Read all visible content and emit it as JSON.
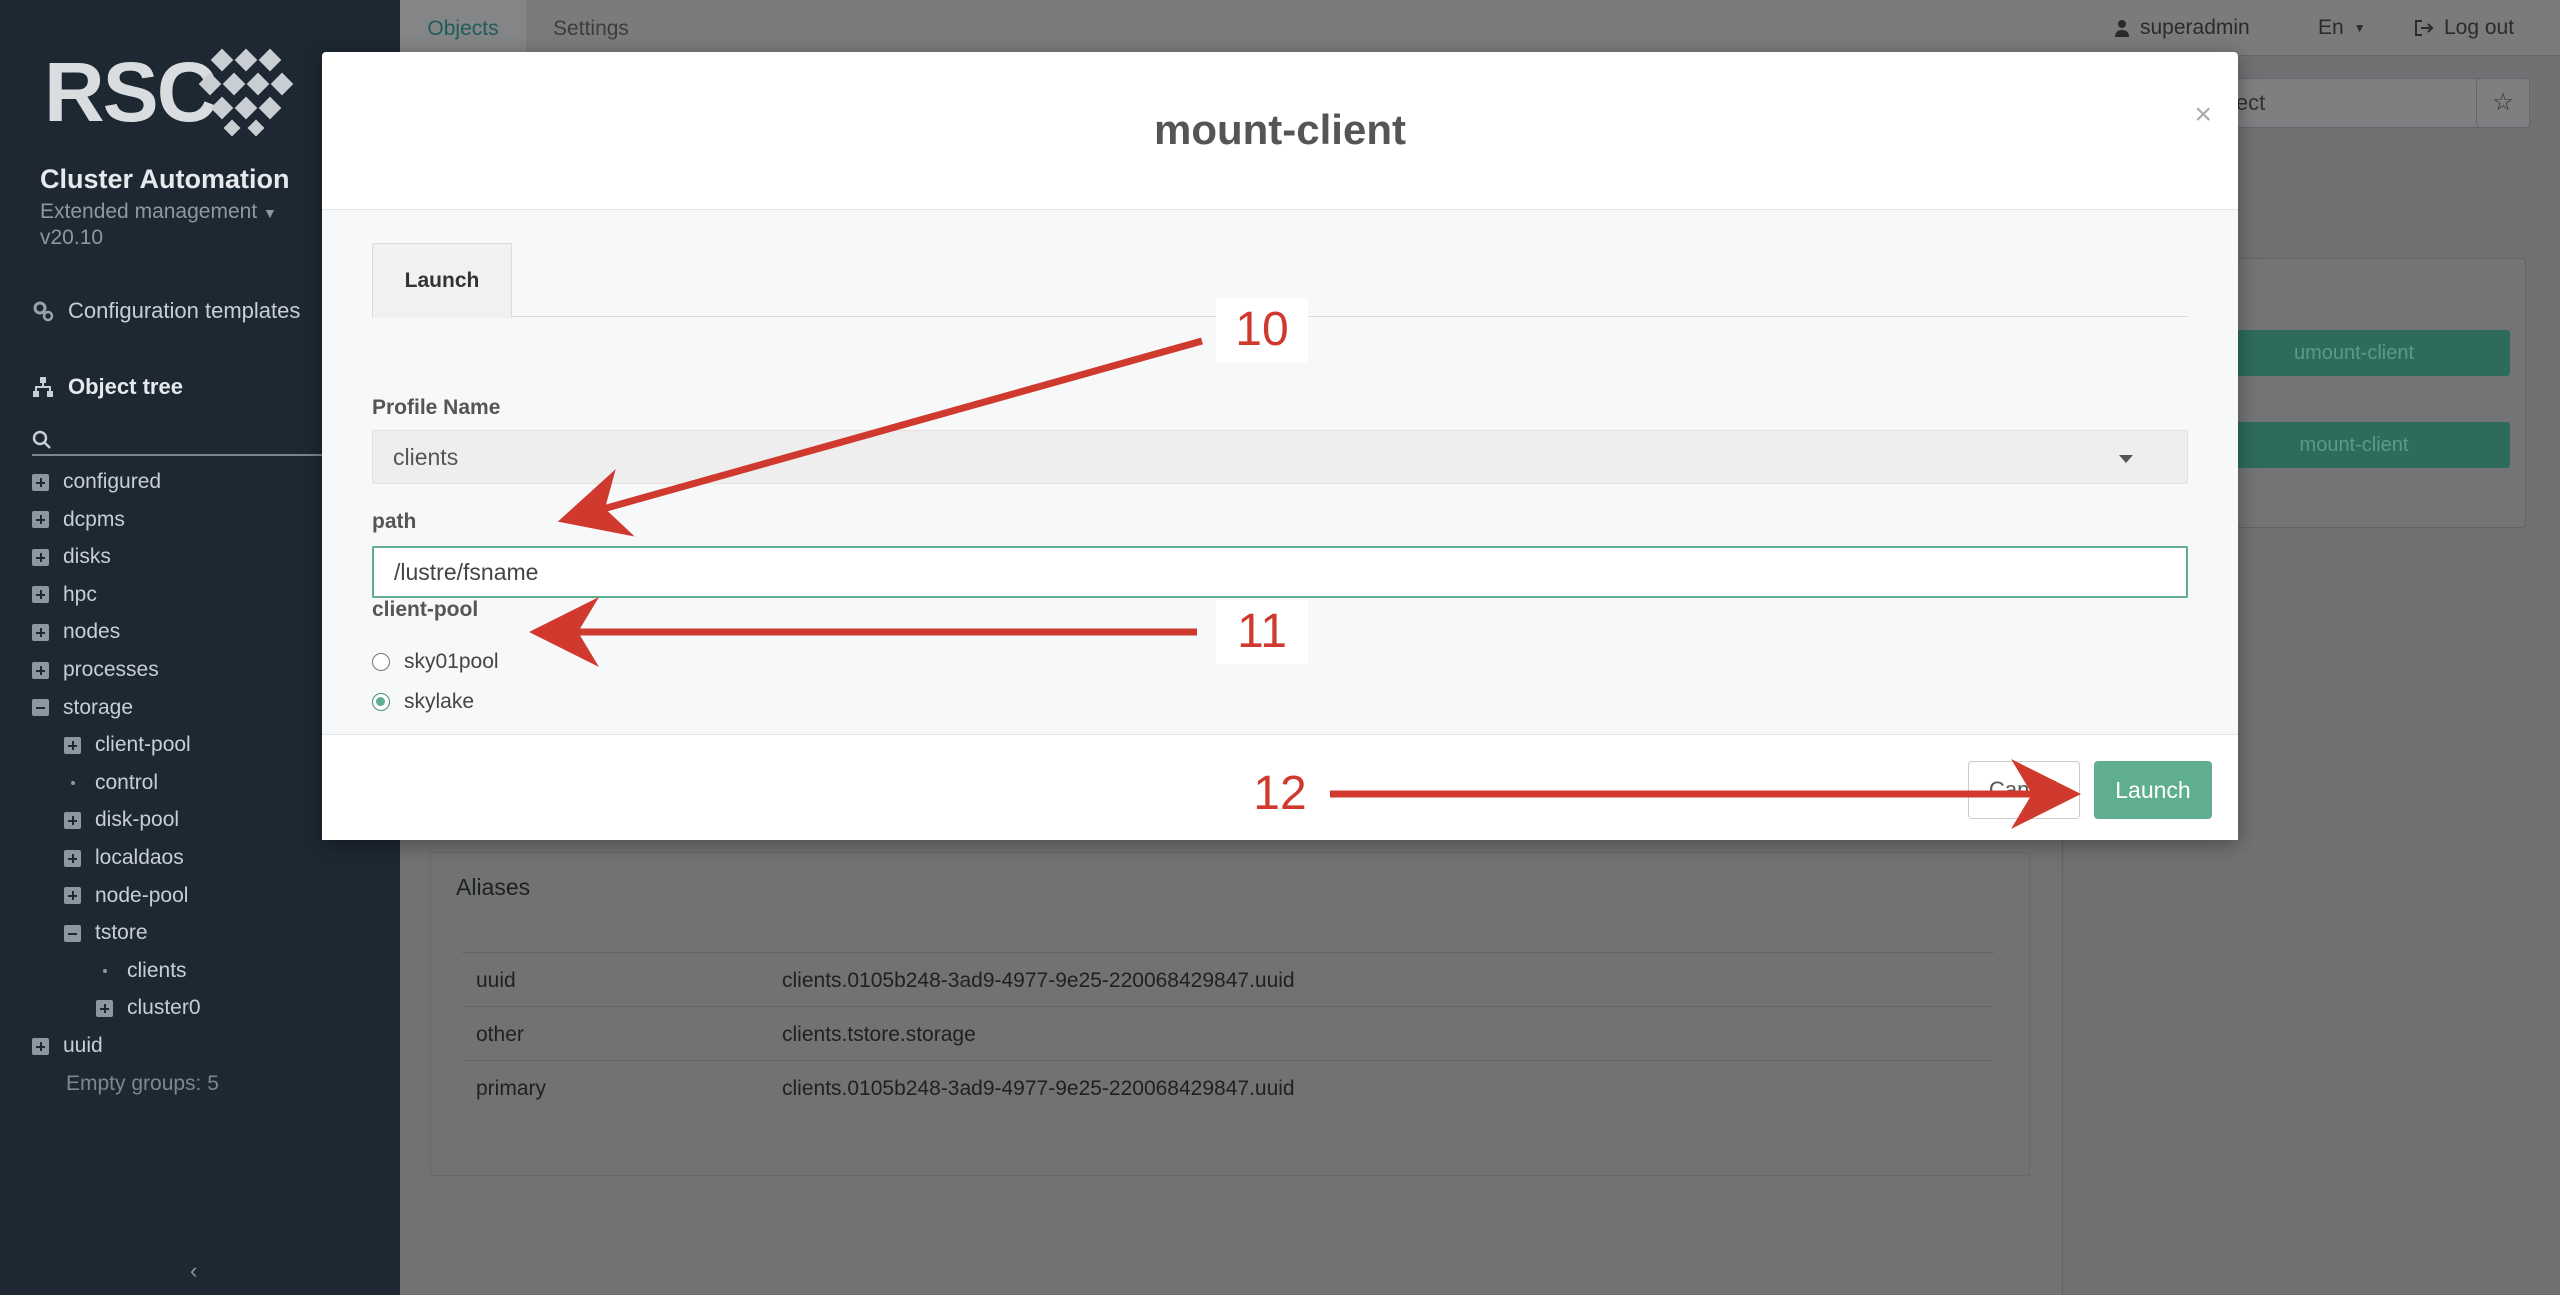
{
  "sidebar": {
    "logo_text": "RSC",
    "app_title": "Cluster Automation",
    "app_subtitle": "Extended management",
    "app_version": "v20.10",
    "config_templates": "Configuration templates",
    "object_tree": "Object tree",
    "tree": [
      {
        "label": "configured",
        "type": "plus"
      },
      {
        "label": "dcpms",
        "type": "plus"
      },
      {
        "label": "disks",
        "type": "plus"
      },
      {
        "label": "hpc",
        "type": "plus"
      },
      {
        "label": "nodes",
        "type": "plus"
      },
      {
        "label": "processes",
        "type": "plus"
      },
      {
        "label": "storage",
        "type": "minus"
      },
      {
        "label": "client-pool",
        "type": "plus"
      },
      {
        "label": "control",
        "type": "dot"
      },
      {
        "label": "disk-pool",
        "type": "plus"
      },
      {
        "label": "localdaos",
        "type": "plus"
      },
      {
        "label": "node-pool",
        "type": "plus"
      },
      {
        "label": "tstore",
        "type": "minus"
      },
      {
        "label": "clients",
        "type": "dot"
      },
      {
        "label": "cluster0",
        "type": "plus"
      },
      {
        "label": "uuid",
        "type": "plus"
      },
      {
        "label": "Empty groups: 5",
        "type": "none"
      }
    ]
  },
  "topbar": {
    "tab_objects": "Objects",
    "tab_settings": "Settings",
    "user": "superadmin",
    "lang": "En",
    "logout": "Log out"
  },
  "right_panel": {
    "select_value": "ject",
    "actions": [
      "umount-client",
      "mount-client"
    ]
  },
  "aliases": {
    "title": "Aliases",
    "rows": [
      {
        "key": "uuid",
        "value": "clients.0105b248-3ad9-4977-9e25-220068429847.uuid"
      },
      {
        "key": "other",
        "value": "clients.tstore.storage"
      },
      {
        "key": "primary",
        "value": "clients.0105b248-3ad9-4977-9e25-220068429847.uuid"
      }
    ]
  },
  "modal": {
    "title": "mount-client",
    "close": "×",
    "tab": "Launch",
    "profile_label": "Profile Name",
    "profile_value": "clients",
    "path_label": "path",
    "path_value": "/lustre/fsname",
    "pool_label": "client-pool",
    "pool_options": [
      {
        "label": "sky01pool",
        "checked": false
      },
      {
        "label": "skylake",
        "checked": true
      }
    ],
    "cancel_label": "Cancel",
    "launch_label": "Launch"
  },
  "annotations": [
    "10",
    "11",
    "12"
  ],
  "colors": {
    "accent": "#5fae8f",
    "annotation": "#d0392d",
    "sidebar": "#1d2833"
  }
}
